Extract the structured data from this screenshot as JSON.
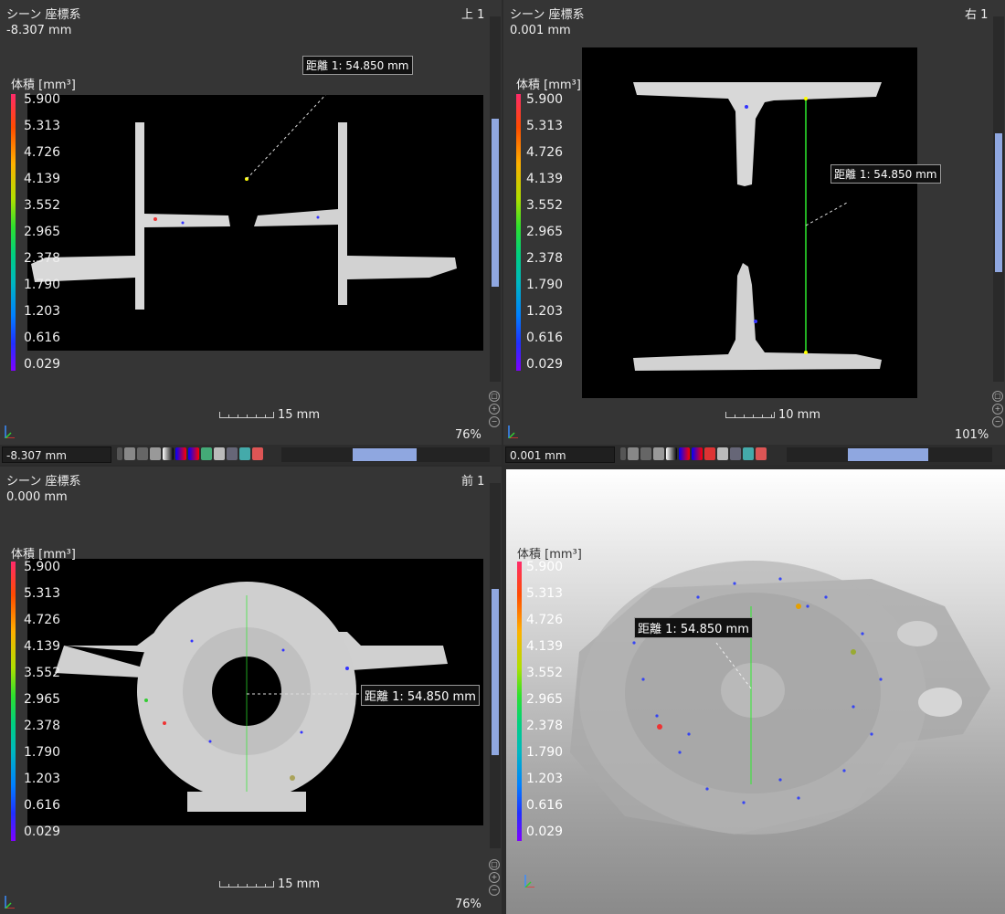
{
  "legend": {
    "title": "体積 [mm³]",
    "values": [
      "5.900",
      "5.313",
      "4.726",
      "4.139",
      "3.552",
      "2.965",
      "2.378",
      "1.790",
      "1.203",
      "0.616",
      "0.029"
    ]
  },
  "panes": {
    "top_left": {
      "title": "シーン 座標系",
      "value": "-8.307 mm",
      "view_name": "上 1",
      "scale": "15 mm",
      "zoom": "76%",
      "toolbar_value": "-8.307 mm",
      "measure_label": "距離 1: 54.850 mm"
    },
    "top_right": {
      "title": "シーン 座標系",
      "value": "0.001 mm",
      "view_name": "右 1",
      "scale": "10 mm",
      "zoom": "101%",
      "toolbar_value": "0.001 mm",
      "measure_label": "距離 1: 54.850 mm"
    },
    "bottom_left": {
      "title": "シーン 座標系",
      "value": "0.000 mm",
      "view_name": "前 1",
      "scale": "15 mm",
      "zoom": "76%",
      "measure_label": "距離 1: 54.850 mm"
    },
    "bottom_right": {
      "measure_label": "距離 1: 54.850 mm"
    }
  },
  "colors": {
    "accent": "#8fa7e0",
    "panel": "#353535",
    "view_bg": "#000000"
  }
}
